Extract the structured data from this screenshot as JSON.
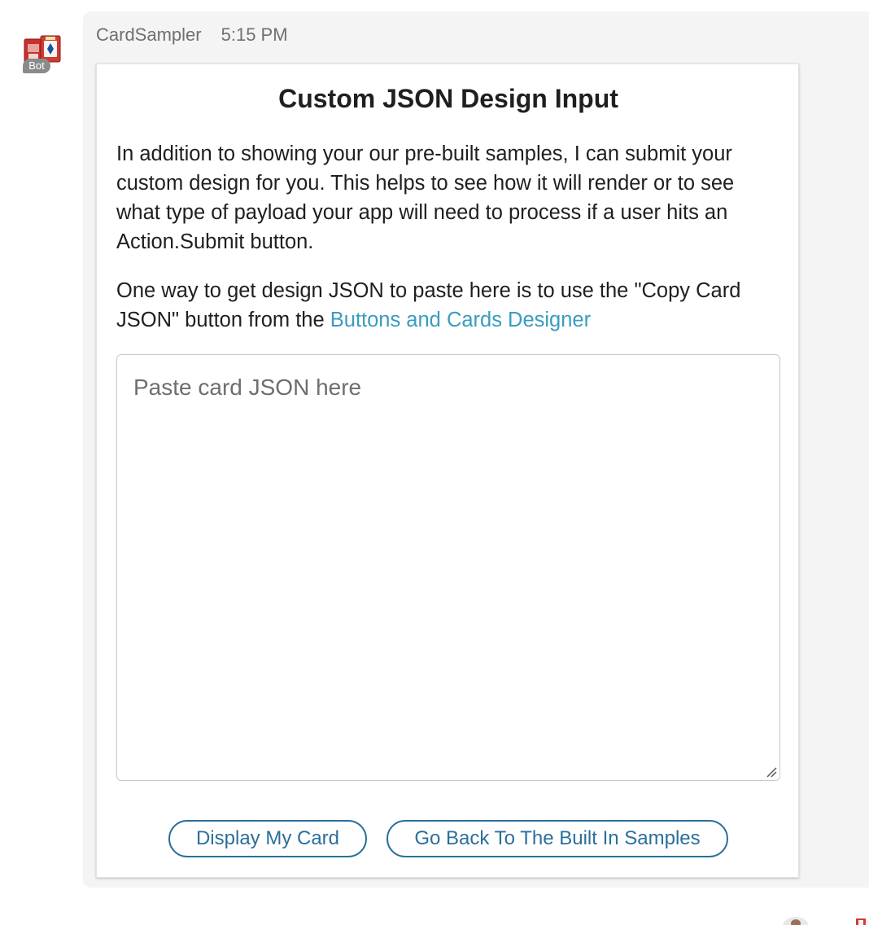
{
  "message": {
    "sender": "CardSampler",
    "time": "5:15 PM",
    "bot_badge": "Bot"
  },
  "card": {
    "title": "Custom JSON Design Input",
    "paragraph_1": "In addition to showing your our pre-built samples, I can submit your custom design for you.  This helps to see how it will render or to see what type of payload your app will need to process if a user hits an Action.Submit button.",
    "paragraph_2_text": "One way to get design JSON to paste here is to use the \"Copy Card JSON\" button from the ",
    "paragraph_2_link": "Buttons and Cards Designer",
    "json_input": {
      "placeholder": "Paste card JSON here",
      "value": ""
    },
    "buttons": {
      "display": "Display My Card",
      "back": "Go Back To The Built In Samples"
    }
  },
  "colors": {
    "link": "#3a9cc0",
    "button": "#2a6f9b",
    "bubble_bg": "#f4f4f4",
    "meta_text": "#6f6f6f"
  },
  "icons": {
    "avatar": "playing-cards-icon",
    "resize": "resize-handle-icon"
  }
}
